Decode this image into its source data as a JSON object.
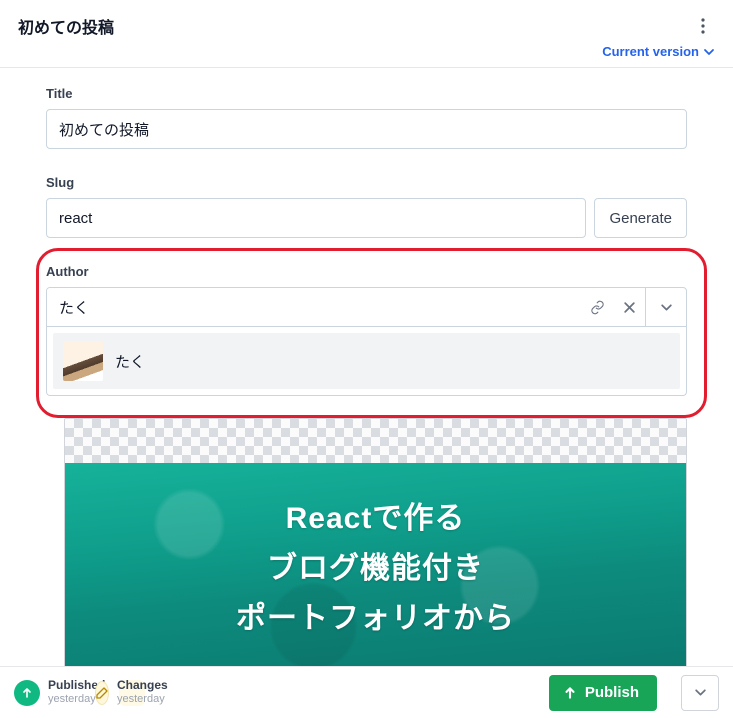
{
  "header": {
    "title": "初めての投稿",
    "version_label": "Current version"
  },
  "fields": {
    "title_label": "Title",
    "title_value": "初めての投稿",
    "slug_label": "Slug",
    "slug_value": "react",
    "generate_label": "Generate",
    "author_label": "Author",
    "author_input": "たく",
    "author_option_name": "たく"
  },
  "hero": {
    "line1": "Reactで作る",
    "line2": "ブログ機能付き",
    "line3": "ポートフォリオから"
  },
  "footer": {
    "published_title": "Published",
    "published_sub": "yesterday",
    "changes_title": "Changes",
    "changes_sub": "yesterday",
    "publish_label": "Publish"
  }
}
